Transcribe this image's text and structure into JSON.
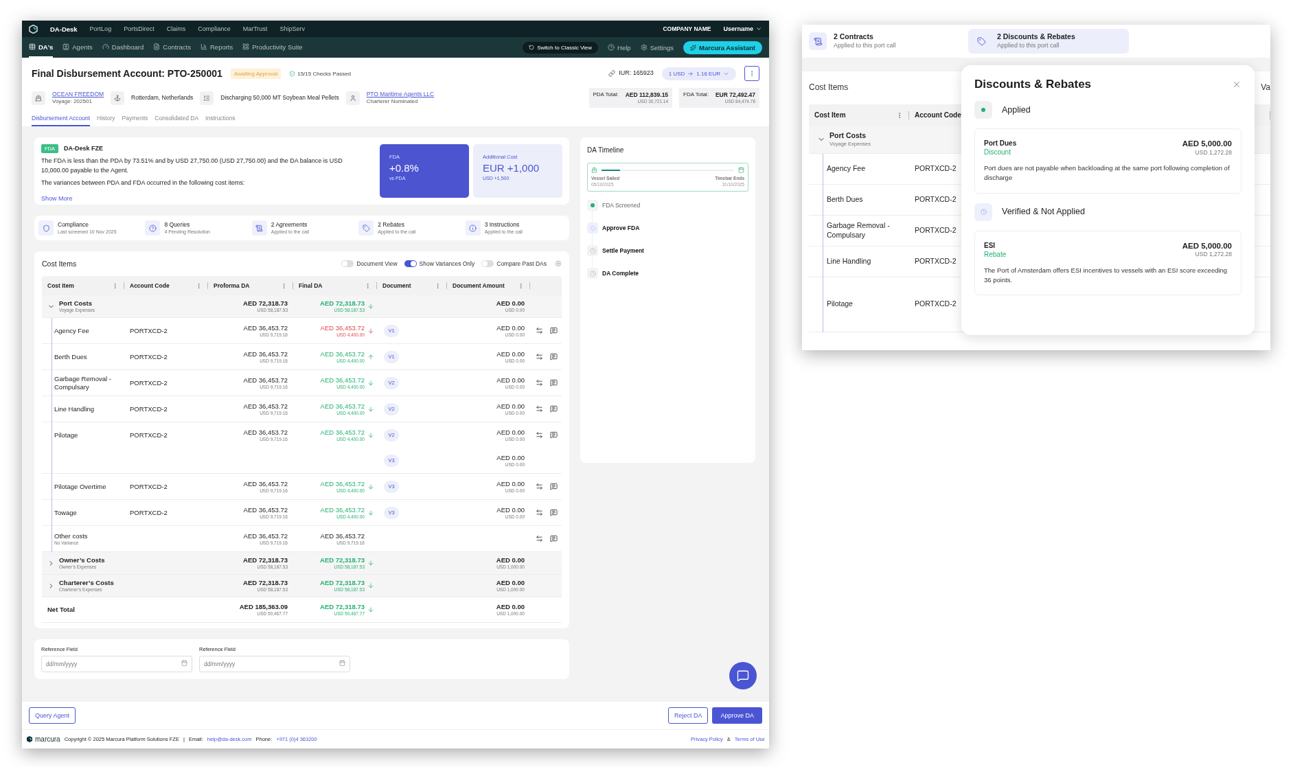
{
  "top_nav": {
    "brand": "DA-Desk",
    "links": [
      "PortLog",
      "PortsDirect",
      "Claims",
      "Compliance",
      "MarTrust",
      "ShipServ"
    ],
    "company": "COMPANY NAME",
    "user": "Username"
  },
  "sub_nav": {
    "tabs": [
      {
        "label": "DA's",
        "selected": true
      },
      {
        "label": "Agents",
        "selected": false
      },
      {
        "label": "Dashboard",
        "selected": false
      },
      {
        "label": "Contracts",
        "selected": false
      },
      {
        "label": "Reports",
        "selected": false
      },
      {
        "label": "Productivity Suite",
        "selected": false
      }
    ],
    "classic_view": "Switch to Classic View",
    "help": "Help",
    "settings": "Settings",
    "assistant": "Marcura Assistant"
  },
  "header": {
    "title": "Final Disbursement Account: PTO-250001",
    "status": "Awaiting Approval",
    "checks": "15/15 Checks Passed",
    "iur": "IUR: 165923",
    "rate_from": "1 USD",
    "rate_to": "1.16 EUR",
    "vessel": "OCEAN FREEDOM",
    "voyage": "Voyage: 202501",
    "port": "Rotterdam, Netherlands",
    "cargo": "Discharging 50,000 MT Soybean Meal Pellets",
    "agent": "PTO Maritime Agents LLC",
    "agent_note": "Charterer Nominated",
    "totals": [
      {
        "label": "PDA Total:",
        "value": "AED 112,839.15",
        "sub": "USD 30,721.14"
      },
      {
        "label": "FDA Total:",
        "value": "EUR 72,492.47",
        "sub": "USD 84,474.76"
      }
    ],
    "tabs": [
      {
        "label": "Disbursement Account",
        "selected": true
      },
      {
        "label": "History",
        "selected": false
      },
      {
        "label": "Payments",
        "selected": false
      },
      {
        "label": "Consolidated DA",
        "selected": false
      },
      {
        "label": "Instructions",
        "selected": false
      }
    ]
  },
  "summary": {
    "badge": "FDA",
    "company": "DA-Desk FZE",
    "lines": [
      "The FDA is less than the PDA by 73.51% and by USD 27,750.00 (USD 27,750.00) and the DA balance is USD 10,000.00 payable to the Agent.",
      "The variances between PDA and FDA occurred in the following cost items:"
    ],
    "more": "Show More",
    "cards": [
      {
        "kind": "primary",
        "label": "FDA",
        "value": "+0.8%",
        "sub": "vs PDA"
      },
      {
        "kind": "light",
        "label": "Additional Cost",
        "value": "EUR +1,000",
        "sub": "USD +1,500"
      }
    ]
  },
  "stats": [
    {
      "title": "Compliance",
      "sub": "Last screened 10 Nov 2025"
    },
    {
      "title": "8 Queries",
      "sub": "4 Pending Resolution"
    },
    {
      "title": "2 Agreements",
      "sub": "Applied to the call"
    },
    {
      "title": "2 Rebates",
      "sub": "Applied to the call"
    },
    {
      "title": "3 Instructions",
      "sub": "Applied to the call"
    }
  ],
  "cost_items": {
    "title": "Cost Items",
    "toggles": [
      {
        "label": "Document View",
        "on": false
      },
      {
        "label": "Show Variances Only",
        "on": true
      },
      {
        "label": "Compare Past DAs",
        "on": false
      }
    ],
    "columns": [
      "Cost Item",
      "Account Code",
      "Proforma DA",
      "Final DA",
      "Document",
      "Document Amount"
    ],
    "groups": [
      {
        "name": "Port Costs",
        "sub": "Voyage Expenses",
        "expanded": true,
        "proforma": "AED 72,318.73",
        "proforma_sub": "USD 58,187.53",
        "final": "AED 72,318.73",
        "final_sub": "USD 58,187.53",
        "variance": true,
        "increase": false,
        "flagged": false,
        "doc_amount": "AED 0.00",
        "doc_amount_sub": "USD 0.00",
        "items": [
          {
            "name": "Agency Fee",
            "code": "PORTXCD-2",
            "proforma": "AED 36,453.72",
            "proforma_sub": "USD 9,719.16",
            "final": "AED 36,453.72",
            "final_sub": "USD 4,400.00",
            "variance": true,
            "increase": false,
            "flagged": true,
            "documents": [
              {
                "version": "V1",
                "amount": "AED 0.00",
                "amount_sub": "USD 0.00"
              }
            ]
          },
          {
            "name": "Berth Dues",
            "code": "PORTXCD-2",
            "proforma": "AED 36,453.72",
            "proforma_sub": "USD 9,719.16",
            "final": "AED 36,453.72",
            "final_sub": "USD 4,400.00",
            "variance": true,
            "increase": true,
            "flagged": false,
            "documents": [
              {
                "version": "V1",
                "amount": "AED 0.00",
                "amount_sub": "USD 0.00"
              }
            ]
          },
          {
            "name": "Garbage Removal - Compulsary",
            "code": "PORTXCD-2",
            "proforma": "AED 36,453.72",
            "proforma_sub": "USD 9,719.16",
            "final": "AED 36,453.72",
            "final_sub": "USD 4,400.00",
            "variance": true,
            "increase": false,
            "flagged": false,
            "documents": [
              {
                "version": "V2",
                "amount": "AED 0.00",
                "amount_sub": "USD 0.00"
              }
            ]
          },
          {
            "name": "Line Handling",
            "code": "PORTXCD-2",
            "proforma": "AED 36,453.72",
            "proforma_sub": "USD 9,719.16",
            "final": "AED 36,453.72",
            "final_sub": "USD 4,400.00",
            "variance": true,
            "increase": false,
            "flagged": false,
            "documents": [
              {
                "version": "V2",
                "amount": "AED 0.00",
                "amount_sub": "USD 0.00"
              }
            ]
          },
          {
            "name": "Pilotage",
            "code": "PORTXCD-2",
            "proforma": "AED 36,453.72",
            "proforma_sub": "USD 9,719.16",
            "final": "AED 36,453.72",
            "final_sub": "USD 4,400.00",
            "variance": true,
            "increase": false,
            "flagged": false,
            "documents": [
              {
                "version": "V2",
                "amount": "AED 0.00",
                "amount_sub": "USD 0.00"
              },
              {
                "version": "V3",
                "amount": "AED 0.00",
                "amount_sub": "USD 0.00"
              }
            ]
          },
          {
            "name": "Pilotage Overtime",
            "code": "PORTXCD-2",
            "proforma": "AED 36,453.72",
            "proforma_sub": "USD 9,719.16",
            "final": "AED 36,453.72",
            "final_sub": "USD 4,400.00",
            "variance": true,
            "increase": false,
            "flagged": false,
            "documents": [
              {
                "version": "V3",
                "amount": "AED 0.00",
                "amount_sub": "USD 0.00"
              }
            ]
          },
          {
            "name": "Towage",
            "code": "PORTXCD-2",
            "proforma": "AED 36,453.72",
            "proforma_sub": "USD 9,719.16",
            "final": "AED 36,453.72",
            "final_sub": "USD 4,400.00",
            "variance": true,
            "increase": false,
            "flagged": false,
            "documents": [
              {
                "version": "V3",
                "amount": "AED 0.00",
                "amount_sub": "USD 0.00"
              }
            ]
          },
          {
            "name": "Other costs",
            "note": "No Variance",
            "proforma": "AED 36,453.72",
            "proforma_sub": "USD 9,719.16",
            "final": "AED 36,453.72",
            "final_sub": "USD 9,719.16",
            "variance": false
          }
        ]
      },
      {
        "name": "Owner’s Costs",
        "sub": "Owner’s Expenses",
        "expanded": false,
        "proforma": "AED 72,318.73",
        "proforma_sub": "USD 58,187.53",
        "final": "AED 72,318.73",
        "final_sub": "USD 58,187.53",
        "variance": true,
        "increase": false,
        "flagged": false,
        "doc_amount": "AED 0.00",
        "doc_amount_sub": "USD 1,000.00"
      },
      {
        "name": "Charterer’s Costs",
        "sub": "Charterer’s Expenses",
        "expanded": false,
        "proforma": "AED 72,318.73",
        "proforma_sub": "USD 58,187.53",
        "final": "AED 72,318.73",
        "final_sub": "USD 58,187.53",
        "variance": true,
        "increase": false,
        "flagged": false,
        "doc_amount": "AED 0.00",
        "doc_amount_sub": "USD 1,000.00"
      }
    ],
    "net_total": {
      "label": "Net Total",
      "proforma": "AED 185,363.09",
      "proforma_sub": "USD 50,467.77",
      "final": "AED 72,318.73",
      "final_sub": "USD 50,467.77",
      "variance": true,
      "increase": false,
      "flagged": false,
      "doc_amount": "AED 0.00",
      "doc_amount_sub": "USD 1,000.00"
    }
  },
  "reference_fields": [
    {
      "label": "Reference Field",
      "placeholder": "dd/mm/yyyy"
    },
    {
      "label": "Reference Field",
      "placeholder": "dd/mm/yyyy"
    }
  ],
  "timeline": {
    "title": "DA Timeline",
    "start_label": "Vessel Sailed",
    "start_date": "05/10/2025",
    "end_label": "Timebar Ends",
    "end_date": "31/10/2025",
    "level": 0.14,
    "steps": [
      {
        "label": "FDA Screened",
        "completed": true,
        "current": false
      },
      {
        "label": "Approve FDA",
        "completed": false,
        "current": true
      },
      {
        "label": "Settle Payment",
        "completed": false,
        "current": false
      },
      {
        "label": "DA Complete",
        "completed": false,
        "current": false
      }
    ]
  },
  "actions": {
    "query": "Query Agent",
    "reject": "Reject DA",
    "approve": "Approve DA"
  },
  "footer": {
    "logo": "marcura",
    "copyright": "Copyright ©  2025 Marcura Platform Solutions FZE",
    "separator": "|",
    "email_label": "Email:",
    "email": "help@da-desk.com",
    "phone_label": "Phone:",
    "phone": "+971 (0)4 363200",
    "privacy": "Privacy Policy",
    "amp": "&",
    "terms": "Terms of Use"
  },
  "detail_view": {
    "strip": [
      {
        "title": "2 Contracts",
        "sub": "Applied to this port call",
        "selected": false
      },
      {
        "title": "2 Discounts & Rebates",
        "sub": "Applied to this port call",
        "selected": true
      }
    ],
    "table_title": "Cost Items",
    "cut_text": "Va",
    "columns": [
      "Cost Item",
      "Account Code"
    ],
    "group": {
      "name": "Port Costs",
      "sub": "Voyage Expenses",
      "expanded": true
    },
    "rows": [
      {
        "name": "Agency Fee",
        "code": "PORTXCD-2"
      },
      {
        "name": "Berth Dues",
        "code": "PORTXCD-2"
      },
      {
        "name": "Garbage Removal - Compulsary",
        "code": "PORTXCD-2"
      },
      {
        "name": "Line Handling",
        "code": "PORTXCD-2"
      },
      {
        "name": "Pilotage",
        "code": "PORTXCD-2"
      }
    ],
    "popover": {
      "title": "Discounts & Rebates",
      "sections": [
        {
          "heading": "Applied",
          "applied": true,
          "items": [
            {
              "name": "Port Dues",
              "type": "Discount",
              "amount": "AED 5,000.00",
              "amount_sub": "USD 1,272.28",
              "description": "Port dues are not payable when backloading at the same port following completion of discharge"
            }
          ]
        },
        {
          "heading": "Verified & Not Applied",
          "applied": false,
          "items": [
            {
              "name": "ESI",
              "type": "Rebate",
              "amount": "AED 5,000.00",
              "amount_sub": "USD 1,272.28",
              "description": "The Port of Amsterdam offers ESI incentives to vessels with an ESI score exceeding 36 points."
            }
          ]
        }
      ]
    }
  }
}
